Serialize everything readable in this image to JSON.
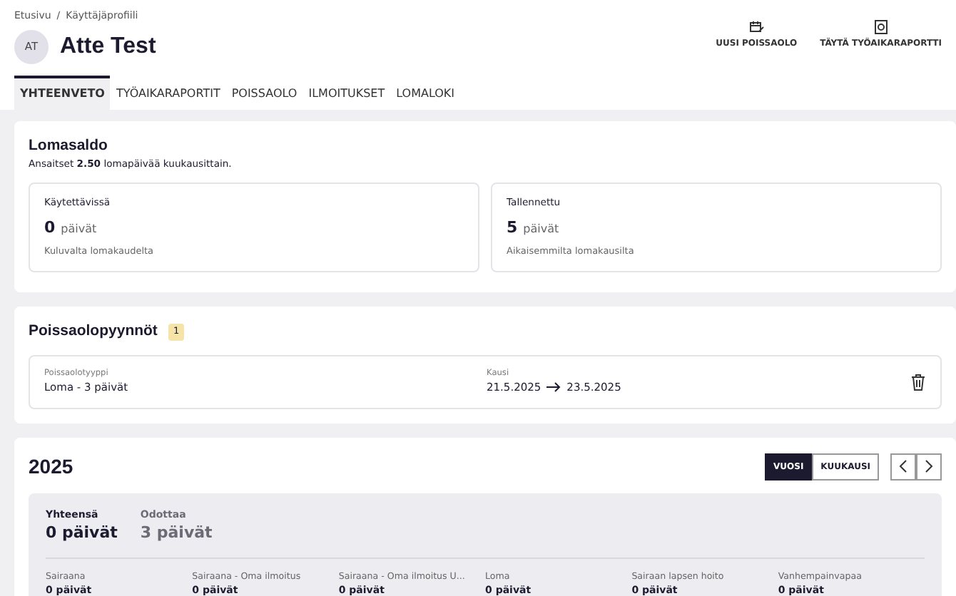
{
  "breadcrumb": [
    "Etusivu",
    "Käyttäjäprofiili"
  ],
  "breadcrumb_separator": "/",
  "user": {
    "initials": "AT",
    "name": "Atte Test"
  },
  "actions": [
    {
      "label": "UUSI POISSAOLO",
      "kind": "calendar"
    },
    {
      "label": "TÄYTÄ TYÖAIKARAPORTTI",
      "kind": "clock"
    }
  ],
  "tabs": [
    {
      "label": "YHTEENVETO",
      "selected": true
    },
    {
      "label": "TYÖAIKARAPORTIT",
      "selected": false
    },
    {
      "label": "POISSAOLO",
      "selected": false
    },
    {
      "label": "ILMOITUKSET",
      "selected": false
    },
    {
      "label": "LOMALOKI",
      "selected": false
    }
  ],
  "vacation_balance": {
    "title": "Lomasaldo",
    "subtitle": "Ansaitset **2.50** lomapäivää kuukausittain.",
    "cards": [
      {
        "label": "Käytettävissä",
        "value": "0",
        "unit": "päivät",
        "note": "Kuluvalta lomakaudelta"
      },
      {
        "label": "Tallennettu",
        "value": "5",
        "unit": "päivät",
        "note": "Aikaisemmilta lomakausilta"
      }
    ]
  },
  "absence_requests": {
    "title": "Poissaolopyynnöt",
    "count": "1",
    "items": [
      {
        "type_label": "Poissaolotyyppi",
        "type": "Loma - 3 päivät",
        "period_label": "Kausi",
        "start": "21.5.2025",
        "end": "23.5.2025"
      }
    ]
  },
  "year_summary": {
    "title": "2025",
    "view_toggle": [
      {
        "label": "VUOSI",
        "selected": true
      },
      {
        "label": "KUUKAUSI",
        "selected": false
      }
    ],
    "totals": [
      {
        "label": "Yhteensä",
        "value": "0 päivät",
        "muted": false
      },
      {
        "label": "Odottaa",
        "value": "3 päivät",
        "muted": true
      }
    ],
    "categories": [
      {
        "label": "Sairaana",
        "value": "0 päivät"
      },
      {
        "label": "Sairaana - Oma ilmoitus",
        "value": "0 päivät"
      },
      {
        "label": "Sairaana - Oma ilmoitus U...",
        "value": "0 päivät"
      },
      {
        "label": "Loma",
        "value": "0 päivät"
      },
      {
        "label": "Sairaan lapsen hoito",
        "value": "0 päivät"
      },
      {
        "label": "Vanhempainvapaa",
        "value": "0 päivät"
      }
    ]
  }
}
